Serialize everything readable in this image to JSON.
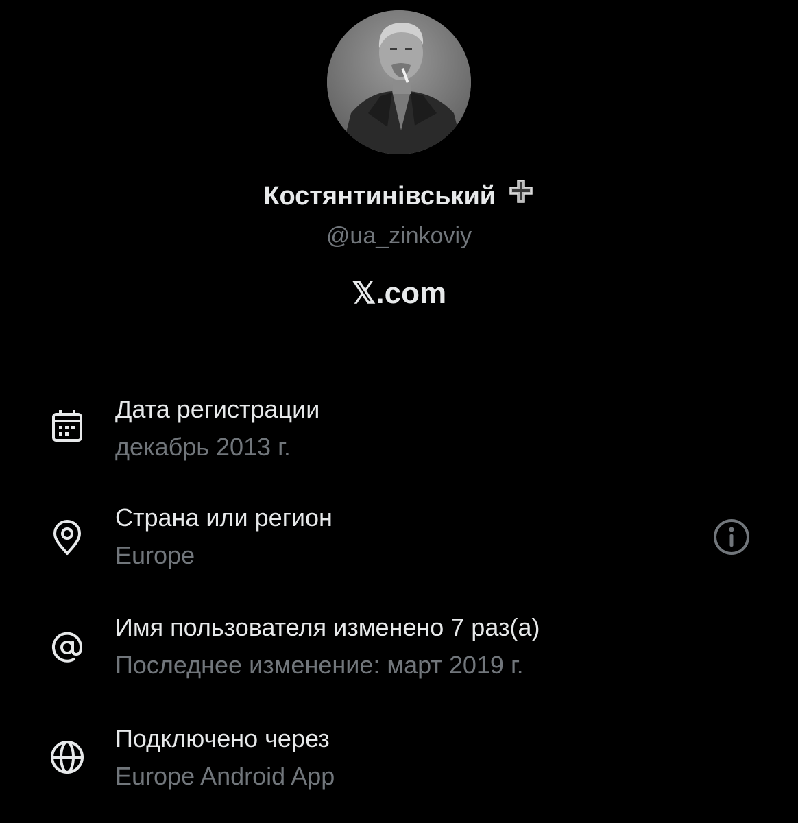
{
  "profile": {
    "display_name": "Костянтинівський",
    "badge_icon": "cross-badge-icon",
    "handle": "@ua_zinkoviy",
    "site": "𝕏.com"
  },
  "details": [
    {
      "icon": "calendar-icon",
      "title": "Дата регистрации",
      "value": "декабрь 2013 г."
    },
    {
      "icon": "location-pin-icon",
      "title": "Страна или регион",
      "value": "Europe"
    },
    {
      "icon": "at-sign-icon",
      "title": "Имя пользователя изменено 7 раз(а)",
      "value": "Последнее изменение: март 2019 г."
    },
    {
      "icon": "globe-icon",
      "title": "Подключено через",
      "value": "Europe Android App"
    }
  ],
  "colors": {
    "background": "#000000",
    "primary_text": "#e7e9ea",
    "secondary_text": "#71767b"
  }
}
